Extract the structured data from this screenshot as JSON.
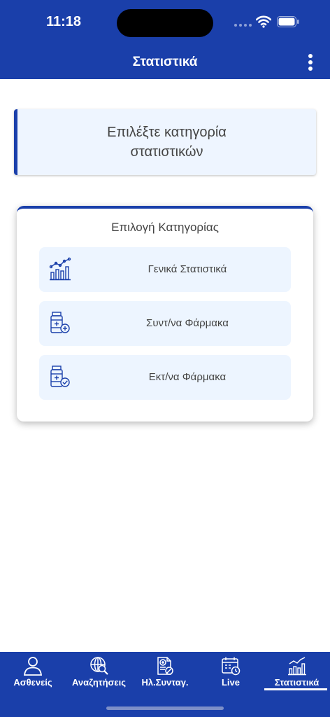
{
  "status_bar": {
    "time": "11:18"
  },
  "header": {
    "title": "Στατιστικά",
    "menu_icon": "more-vertical-icon"
  },
  "info_box": {
    "text": "Επιλέξτε κατηγορία στατιστικών"
  },
  "category_card": {
    "title": "Επιλογή Κατηγορίας",
    "options": [
      {
        "label": "Γενικά Στατιστικά",
        "icon": "chart-growth-icon"
      },
      {
        "label": "Συντ/να Φάρμακα",
        "icon": "medicine-plus-icon"
      },
      {
        "label": "Εκτ/να Φάρμακα",
        "icon": "medicine-check-icon"
      }
    ]
  },
  "tabs": [
    {
      "label": "Ασθενείς",
      "icon": "person-icon"
    },
    {
      "label": "Αναζητήσεις",
      "icon": "search-globe-icon"
    },
    {
      "label": "Ηλ.Συνταγ.",
      "icon": "prescription-icon"
    },
    {
      "label": "Live",
      "icon": "calendar-clock-icon"
    },
    {
      "label": "Στατιστικά",
      "icon": "chart-growth-icon",
      "active": true
    }
  ],
  "colors": {
    "brand": "#1a3faa",
    "option_bg": "#edf5ff",
    "text": "#444444"
  }
}
